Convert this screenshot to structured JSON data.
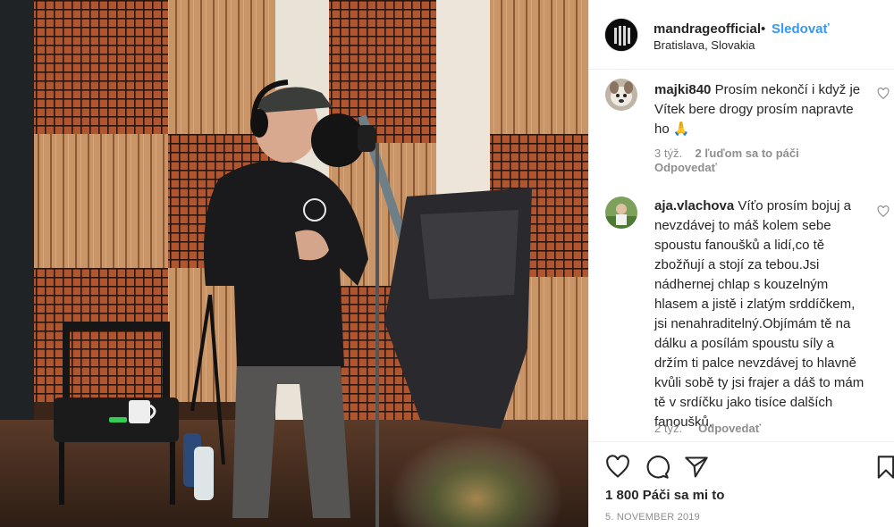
{
  "post": {
    "username": "mandrageofficial",
    "separator": "•",
    "follow_label": "Sledovať",
    "location": "Bratislava, Slovakia",
    "photo_subject": "singer-in-recording-studio"
  },
  "comments": [
    {
      "username": "majki840",
      "text": "Prosím nekončí i když je Vítek bere drogy prosím napravte ho 🙏",
      "time": "3 týž.",
      "likes": "2 ľuďom sa to páči",
      "reply_label": "Odpovedať"
    },
    {
      "username": "aja.vlachova",
      "text": "Víťo prosím bojuj a nevzdávej to máš kolem sebe spoustu fanoušků a lidí,co tě zbožňují a stojí za tebou.Jsi nádhernej chlap s kouzelným hlasem a jistě i zlatým srddíčkem, jsi nenahraditelný.Objímám tě na dálku a posílám spoustu síly a držím ti palce nevzdávej to hlavně kvůli sobě ty jsi frajer a dáš to mám tě v srdíčku jako tisíce dalších fanoušků.",
      "time": "2 týž.",
      "reply_label": "Odpovedať"
    }
  ],
  "actions": {
    "like_icon": "heart-icon",
    "comment_icon": "comment-icon",
    "share_icon": "share-icon",
    "save_icon": "bookmark-icon"
  },
  "likes_count": "1 800 Páči sa mi to",
  "date": "5. NOVEMBER 2019",
  "colors": {
    "link_blue": "#3897f0",
    "text": "#262626",
    "muted": "#8e8e8e",
    "border": "#efefef"
  }
}
